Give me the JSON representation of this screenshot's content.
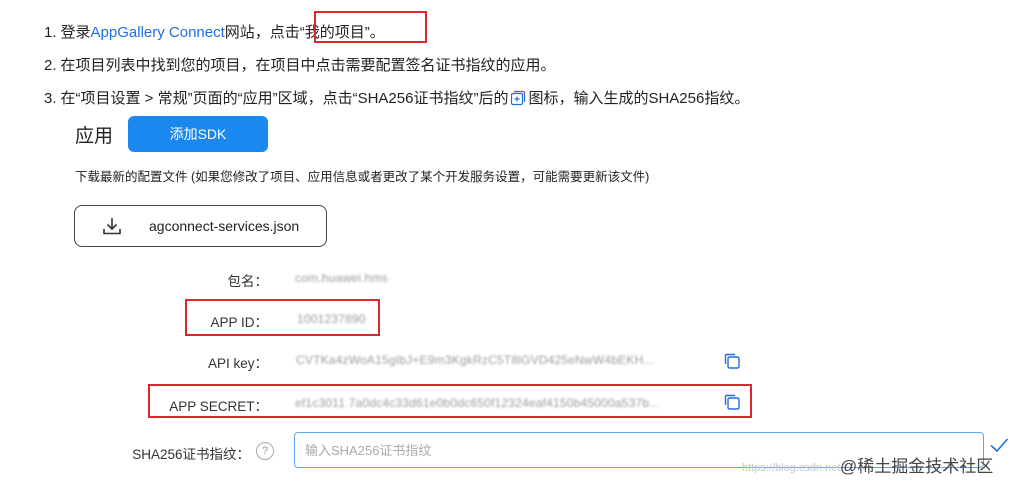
{
  "steps": [
    {
      "num": "1.",
      "pre": "登录",
      "link": "AppGallery Connect",
      "post": "网站，点击",
      "quoted": "“我的项目”",
      "end": "。"
    },
    {
      "num": "2.",
      "text": "在项目列表中找到您的项目，在项目中点击需要配置签名证书指纹的应用。"
    },
    {
      "num": "3.",
      "pre": "在“项目设置 > 常规”页面的“应用”区域，点击“SHA256证书指纹”后的",
      "post": "图标，输入生成的SHA256指纹。"
    }
  ],
  "app_section": {
    "title": "应用",
    "add_sdk_label": "添加SDK",
    "download_desc": "下载最新的配置文件 (如果您修改了项目、应用信息或者更改了某个开发服务设置，可能需要更新该文件)",
    "download_file": "agconnect-services.json"
  },
  "fields": {
    "package": {
      "label": "包名：",
      "value": "com.huawei.hms"
    },
    "app_id": {
      "label": "APP ID：",
      "value": "1001237890"
    },
    "api_key": {
      "label": "API key：",
      "value": "CVTKa4zWoA15gIbJ+E9m3KgkRzC5T8lGVD425eNwW4bEKH..."
    },
    "app_secret": {
      "label": "APP SECRET：",
      "value": "ef1c3011 7a0dc4c33d61e0b0dc650f12324eaf4150b45000a537b..."
    },
    "sha256": {
      "label": "SHA256证书指纹：",
      "placeholder": "输入SHA256证书指纹",
      "help": "?"
    }
  },
  "watermark": {
    "text": "@稀土掘金技术社区",
    "faint": "https://blog.csdn.net/..."
  },
  "colors": {
    "accent": "#1a88ee",
    "link": "#1f6fde",
    "highlight": "#d8282b"
  }
}
